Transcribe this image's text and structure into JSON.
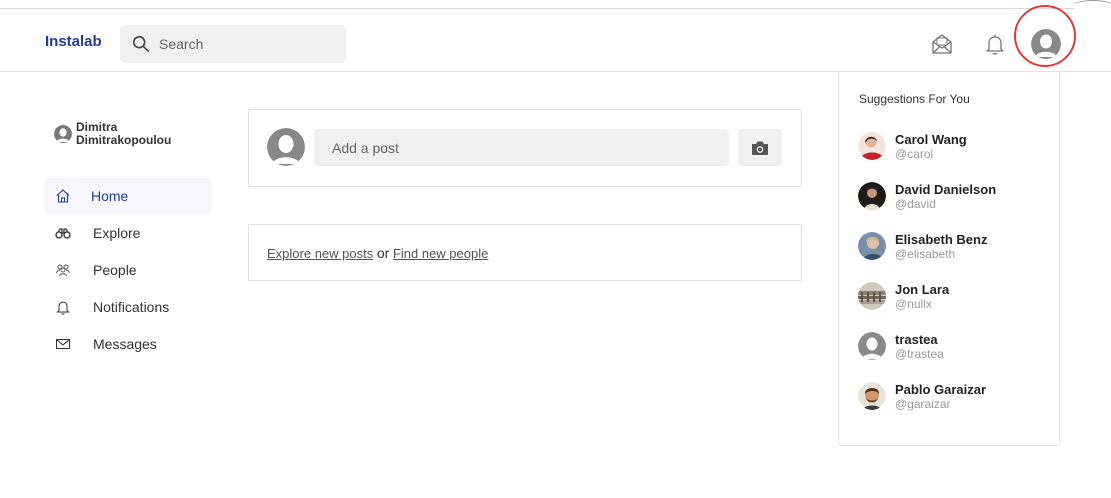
{
  "header": {
    "brand": "Instalab",
    "search_placeholder": "Search"
  },
  "user": {
    "name": "Dimitra Dimitrakopoulou"
  },
  "nav": {
    "items": [
      {
        "label": "Home",
        "icon": "home-icon",
        "active": true
      },
      {
        "label": "Explore",
        "icon": "binoculars-icon",
        "active": false
      },
      {
        "label": "People",
        "icon": "people-icon",
        "active": false
      },
      {
        "label": "Notifications",
        "icon": "bell-icon",
        "active": false
      },
      {
        "label": "Messages",
        "icon": "envelope-icon",
        "active": false
      }
    ]
  },
  "composer": {
    "placeholder": "Add a post"
  },
  "explore": {
    "link1": "Explore new posts",
    "or_text": "or",
    "link2": "Find new people"
  },
  "suggestions": {
    "title": "Suggestions For You",
    "items": [
      {
        "name": "Carol Wang",
        "handle": "@carol",
        "avatar_color": "#c8202a"
      },
      {
        "name": "David Danielson",
        "handle": "@david",
        "avatar_color": "#2b2420"
      },
      {
        "name": "Elisabeth Benz",
        "handle": "@elisabeth",
        "avatar_color": "#7b8fa6"
      },
      {
        "name": "Jon Lara",
        "handle": "@nullx",
        "avatar_color": "#a89f92"
      },
      {
        "name": "trastea",
        "handle": "@trastea",
        "avatar_color": "#8a8a8a"
      },
      {
        "name": "Pablo Garaizar",
        "handle": "@garaizar",
        "avatar_color": "#6b4a2c"
      }
    ]
  },
  "colors": {
    "brand": "#2a3a8c",
    "highlight_ring": "#e03b3b",
    "default_avatar": "#888888"
  }
}
